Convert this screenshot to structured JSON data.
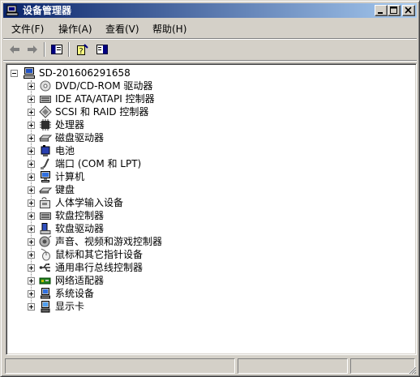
{
  "window": {
    "title": "设备管理器",
    "icon": "device-manager-icon"
  },
  "menu": [
    "文件(F)",
    "操作(A)",
    "查看(V)",
    "帮助(H)"
  ],
  "toolbar": {
    "buttons": [
      "back-arrow-icon",
      "forward-arrow-icon",
      "properties-icon",
      "help-icon",
      "view-icon"
    ]
  },
  "tree": {
    "root": "SD-201606291658",
    "items": [
      {
        "label": "DVD/CD-ROM 驱动器",
        "icon": "dvd-drive-icon"
      },
      {
        "label": "IDE ATA/ATAPI 控制器",
        "icon": "ide-controller-icon"
      },
      {
        "label": "SCSI 和 RAID 控制器",
        "icon": "scsi-controller-icon"
      },
      {
        "label": "处理器",
        "icon": "processor-icon"
      },
      {
        "label": "磁盘驱动器",
        "icon": "disk-drive-icon"
      },
      {
        "label": "电池",
        "icon": "battery-icon"
      },
      {
        "label": "端口 (COM 和 LPT)",
        "icon": "port-icon"
      },
      {
        "label": "计算机",
        "icon": "computer-icon"
      },
      {
        "label": "键盘",
        "icon": "keyboard-icon"
      },
      {
        "label": "人体学输入设备",
        "icon": "hid-icon"
      },
      {
        "label": "软盘控制器",
        "icon": "floppy-controller-icon"
      },
      {
        "label": "软盘驱动器",
        "icon": "floppy-drive-icon"
      },
      {
        "label": "声音、视频和游戏控制器",
        "icon": "sound-icon"
      },
      {
        "label": "鼠标和其它指针设备",
        "icon": "mouse-icon"
      },
      {
        "label": "通用串行总线控制器",
        "icon": "usb-icon"
      },
      {
        "label": "网络适配器",
        "icon": "network-adapter-icon"
      },
      {
        "label": "系统设备",
        "icon": "system-device-icon"
      },
      {
        "label": "显示卡",
        "icon": "display-adapter-icon"
      }
    ]
  },
  "colors": {
    "titlebar_start": "#0a246a",
    "titlebar_end": "#a6caf0",
    "face": "#d4d0c8"
  }
}
